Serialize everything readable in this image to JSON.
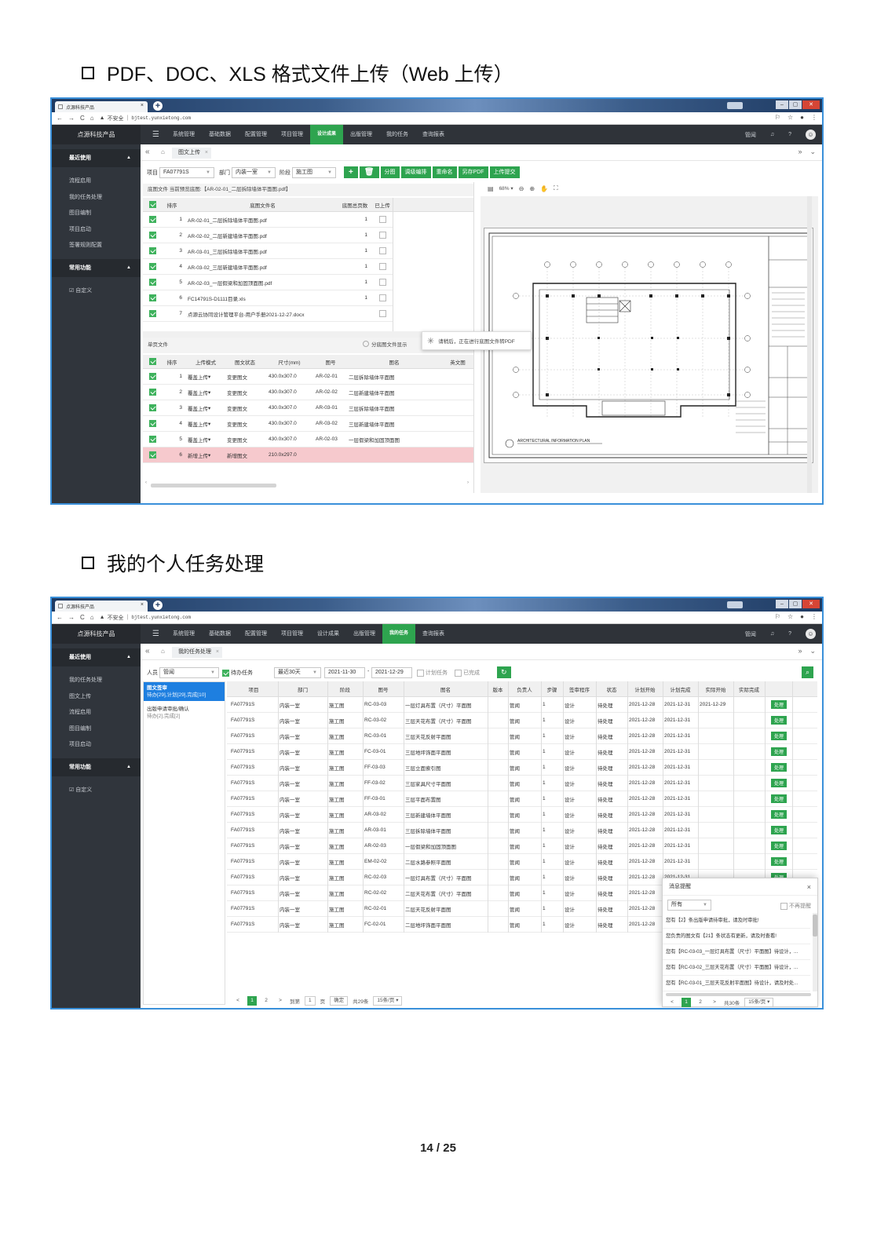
{
  "heading1": "PDF、DOC、XLS 格式文件上传（Web 上传）",
  "heading2": "我的个人任务处理",
  "page_number": "14 / 25",
  "browser": {
    "tab_title": "点源科技产品",
    "insecure_label": "不安全",
    "url": "bjtest.yunxietong.com"
  },
  "app": {
    "brand": "点源科技产品",
    "nav": [
      "系统管理",
      "基础数据",
      "配置管理",
      "项目管理",
      "设计成果",
      "出版管理",
      "我的任务",
      "查询报表"
    ],
    "user": "管闻",
    "help": "?"
  },
  "colors": {
    "accent_green": "#2ea44f",
    "nav_bg": "#2f3339",
    "selected_blue": "#1e7fe0",
    "new_row_pink": "#f6c9cd"
  },
  "s1": {
    "active_nav": "设计成果",
    "sidebar": [
      {
        "section": "最近使用",
        "items": [
          "流程启用",
          "我的任务处理",
          "图目编制",
          "项目启动",
          "签署规则配置"
        ]
      },
      {
        "section": "常用功能",
        "items": [
          "自定义"
        ]
      }
    ],
    "page_tab": "图文上传",
    "toolbar": {
      "project_label": "项目",
      "project_value": "FA07791S",
      "dept_label": "部门",
      "dept_value": "内装一室",
      "stage_label": "阶段",
      "stage_value": "施工图",
      "buttons": [
        "+",
        "🗑",
        "分图",
        "调级编排",
        "重命名",
        "另存PDF",
        "上传提交"
      ]
    },
    "base_files_caption": "底图文件 当前预览底图:【AR-02-01_二层拆除墙体平面图.pdf】",
    "base_files": {
      "headers": [
        "排序",
        "底图文件名",
        "底图总页数",
        "已上传"
      ],
      "rows": [
        {
          "no": "1",
          "name": "AR-02-01_二层拆除墙体平面图.pdf",
          "pages": "1"
        },
        {
          "no": "2",
          "name": "AR-02-02_二层新建墙体平面图.pdf",
          "pages": "1"
        },
        {
          "no": "3",
          "name": "AR-03-01_三层拆除墙体平面图.pdf",
          "pages": "1"
        },
        {
          "no": "4",
          "name": "AR-03-02_三层新建墙体平面图.pdf",
          "pages": "1"
        },
        {
          "no": "5",
          "name": "AR-02-03_一层假梁和加固顶面图.pdf",
          "pages": "1"
        },
        {
          "no": "6",
          "name": "FC14791S-D1111目录.xls",
          "pages": "1"
        },
        {
          "no": "7",
          "name": "点源云协同设计管理平台-用户手册2021-12-27.docx",
          "pages": ""
        }
      ]
    },
    "single_files_caption": "单页文件",
    "split_option": "分底图文件显示",
    "single_files": {
      "headers": [
        "排序",
        "上传模式",
        "图文状态",
        "尺寸(mm)",
        "图号",
        "图名",
        "英文图"
      ],
      "rows": [
        {
          "no": "1",
          "mode": "覆盖上传",
          "status": "变更图文",
          "size": "430.0x307.0",
          "code": "AR-02-01",
          "name": "二层拆除墙体平面图",
          "new": false
        },
        {
          "no": "2",
          "mode": "覆盖上传",
          "status": "变更图文",
          "size": "430.0x307.0",
          "code": "AR-02-02",
          "name": "二层新建墙体平面图",
          "new": false
        },
        {
          "no": "3",
          "mode": "覆盖上传",
          "status": "变更图文",
          "size": "430.0x307.0",
          "code": "AR-03-01",
          "name": "三层拆除墙体平面图",
          "new": false
        },
        {
          "no": "4",
          "mode": "覆盖上传",
          "status": "变更图文",
          "size": "430.0x307.0",
          "code": "AR-03-02",
          "name": "三层新建墙体平面图",
          "new": false
        },
        {
          "no": "5",
          "mode": "覆盖上传",
          "status": "变更图文",
          "size": "430.0x307.0",
          "code": "AR-02-03",
          "name": "一层假梁和加固顶面图",
          "new": false
        },
        {
          "no": "6",
          "mode": "新增上传",
          "status": "新增图文",
          "size": "210.0x297.0",
          "code": "",
          "name": "",
          "new": true
        }
      ]
    },
    "loading_text": "请稍后，正在进行底图文件转PDF",
    "preview": {
      "zoom": "68%",
      "plan_title": "ARCHITECTURAL INFORMATION PLAN"
    }
  },
  "s2": {
    "active_nav": "我的任务",
    "sidebar": [
      {
        "section": "最近使用",
        "items": [
          "我的任务处理",
          "图文上传",
          "流程启用",
          "图目编制",
          "项目启动"
        ]
      },
      {
        "section": "常用功能",
        "items": [
          "自定义"
        ]
      }
    ],
    "page_tab": "我的任务处理",
    "filter": {
      "person_label": "人员",
      "person_value": "管闻",
      "todo_label": "待办任务",
      "range_value": "最近30天",
      "date_from": "2021-11-30",
      "date_to": "2021-12-29",
      "planned_label": "计划任务",
      "done_label": "已完成"
    },
    "task_types": [
      {
        "title": "图文签审",
        "counts": "待办[29],计划[29],完成[10]",
        "selected": true
      },
      {
        "title": "出版申请审批/确认",
        "counts": "待办[2],完成[2]",
        "selected": false
      }
    ],
    "table": {
      "headers": [
        "项目",
        "部门",
        "阶段",
        "图号",
        "图名",
        "版本",
        "负责人",
        "步骤",
        "签审程序",
        "状态",
        "计划开始",
        "计划完成",
        "实际开始",
        "实际完成"
      ],
      "action_label": "处理",
      "rows": [
        [
          "FA07791S",
          "内装一室",
          "施工图",
          "RC-03-03",
          "一层灯具布置（尺寸）平面图",
          "",
          "管闻",
          "1",
          "设计",
          "待处理",
          "2021-12-28",
          "2021-12-31",
          "2021-12-29",
          ""
        ],
        [
          "FA07791S",
          "内装一室",
          "施工图",
          "RC-03-02",
          "三层天花布置（尺寸）平面图",
          "",
          "管闻",
          "1",
          "设计",
          "待处理",
          "2021-12-28",
          "2021-12-31",
          "",
          ""
        ],
        [
          "FA07791S",
          "内装一室",
          "施工图",
          "RC-03-01",
          "三层天花反射平面图",
          "",
          "管闻",
          "1",
          "设计",
          "待处理",
          "2021-12-28",
          "2021-12-31",
          "",
          ""
        ],
        [
          "FA07791S",
          "内装一室",
          "施工图",
          "FC-03-01",
          "三层地坪饰面平面图",
          "",
          "管闻",
          "1",
          "设计",
          "待处理",
          "2021-12-28",
          "2021-12-31",
          "",
          ""
        ],
        [
          "FA07791S",
          "内装一室",
          "施工图",
          "FF-03-03",
          "三层立面索引图",
          "",
          "管闻",
          "1",
          "设计",
          "待处理",
          "2021-12-28",
          "2021-12-31",
          "",
          ""
        ],
        [
          "FA07791S",
          "内装一室",
          "施工图",
          "FF-03-02",
          "三层家具尺寸平面图",
          "",
          "管闻",
          "1",
          "设计",
          "待处理",
          "2021-12-28",
          "2021-12-31",
          "",
          ""
        ],
        [
          "FA07791S",
          "内装一室",
          "施工图",
          "FF-03-01",
          "三层平面布置图",
          "",
          "管闻",
          "1",
          "设计",
          "待处理",
          "2021-12-28",
          "2021-12-31",
          "",
          ""
        ],
        [
          "FA07791S",
          "内装一室",
          "施工图",
          "AR-03-02",
          "三层新建墙体平面图",
          "",
          "管闻",
          "1",
          "设计",
          "待处理",
          "2021-12-28",
          "2021-12-31",
          "",
          ""
        ],
        [
          "FA07791S",
          "内装一室",
          "施工图",
          "AR-03-01",
          "三层拆除墙体平面图",
          "",
          "管闻",
          "1",
          "设计",
          "待处理",
          "2021-12-28",
          "2021-12-31",
          "",
          ""
        ],
        [
          "FA07791S",
          "内装一室",
          "施工图",
          "AR-02-03",
          "一层假梁和加固顶面图",
          "",
          "管闻",
          "1",
          "设计",
          "待处理",
          "2021-12-28",
          "2021-12-31",
          "",
          ""
        ],
        [
          "FA07791S",
          "内装一室",
          "施工图",
          "EM-02-02",
          "二层水路参照平面图",
          "",
          "管闻",
          "1",
          "设计",
          "待处理",
          "2021-12-28",
          "2021-12-31",
          "",
          ""
        ],
        [
          "FA07791S",
          "内装一室",
          "施工图",
          "RC-02-03",
          "一层灯具布置（尺寸）平面图",
          "",
          "管闻",
          "1",
          "设计",
          "待处理",
          "2021-12-28",
          "2021-12-31",
          "",
          ""
        ],
        [
          "FA07791S",
          "内装一室",
          "施工图",
          "RC-02-02",
          "二层天花布置（尺寸）平面图",
          "",
          "管闻",
          "1",
          "设计",
          "待处理",
          "2021-12-28",
          "",
          "",
          ""
        ],
        [
          "FA07791S",
          "内装一室",
          "施工图",
          "RC-02-01",
          "二层天花反射平面图",
          "",
          "管闻",
          "1",
          "设计",
          "待处理",
          "2021-12-28",
          "",
          "",
          ""
        ],
        [
          "FA07791S",
          "内装一室",
          "施工图",
          "FC-02-01",
          "二层地坪饰面平面图",
          "",
          "管闻",
          "1",
          "设计",
          "待处理",
          "2021-12-28",
          "",
          "",
          ""
        ]
      ]
    },
    "pager": {
      "prev": "<",
      "pages": [
        "1",
        "2"
      ],
      "next": ">",
      "goto_label": "到第",
      "goto_value": "1",
      "page_unit": "页",
      "confirm": "确定",
      "total": "共29条",
      "per_page": "15条/页"
    },
    "popup": {
      "title": "消息提醒",
      "filter_value": "所有",
      "mute_label": "不再提醒",
      "messages": [
        "您有【2】条出版申请待审批，请及时审批!",
        "您负责的图文有【21】条状态有更新，请及时查看!",
        "您有【RC-03-03_一层灯具布置（尺寸）平面图】待设计，...",
        "您有【RC-03-02_三层天花布置（尺寸）平面图】待设计，...",
        "您有【RC-03-01_三层天花反射平面图】待设计，请及时处..."
      ],
      "pager": {
        "pages": [
          "1",
          "2"
        ],
        "total": "共30条",
        "per_page": "15条/页"
      }
    }
  }
}
